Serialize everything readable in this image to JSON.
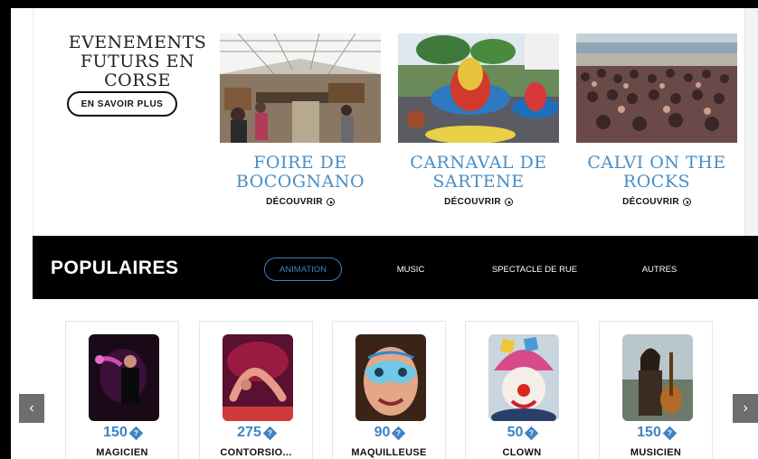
{
  "events": {
    "title": "EVENEMENTS FUTURS EN CORSE",
    "cta_label": "EN SAVOIR PLUS",
    "items": [
      {
        "name": "FOIRE DE BOCOGNANO",
        "link_label": "DÉCOUVRIR",
        "photo": "market-tent"
      },
      {
        "name": "CARNAVAL DE SARTENE",
        "link_label": "DÉCOUVRIR",
        "photo": "carnival-costume"
      },
      {
        "name": "CALVI ON THE ROCKS",
        "link_label": "DÉCOUVRIR",
        "photo": "beach-crowd"
      }
    ]
  },
  "popular": {
    "title": "POPULAIRES",
    "tabs": [
      {
        "label": "ANIMATION",
        "active": true
      },
      {
        "label": "MUSIC",
        "active": false
      },
      {
        "label": "SPECTACLE DE RUE",
        "active": false
      },
      {
        "label": "AUTRES",
        "active": false
      }
    ],
    "cards": [
      {
        "price": "150",
        "name": "MAGICIEN",
        "photo": "magician"
      },
      {
        "price": "275",
        "name": "CONTORSIO...",
        "photo": "contortionist"
      },
      {
        "price": "90",
        "name": "MAQUILLEUSE",
        "photo": "face-paint"
      },
      {
        "price": "50",
        "name": "CLOWN",
        "photo": "clown"
      },
      {
        "price": "150",
        "name": "MUSICIEN",
        "photo": "musician"
      }
    ],
    "currency_glyph": "?",
    "prev_icon": "chevron-left-icon",
    "next_icon": "chevron-right-icon"
  },
  "colors": {
    "accent": "#3e84c4",
    "event_name": "#4a8ec4",
    "bar": "#000000"
  }
}
